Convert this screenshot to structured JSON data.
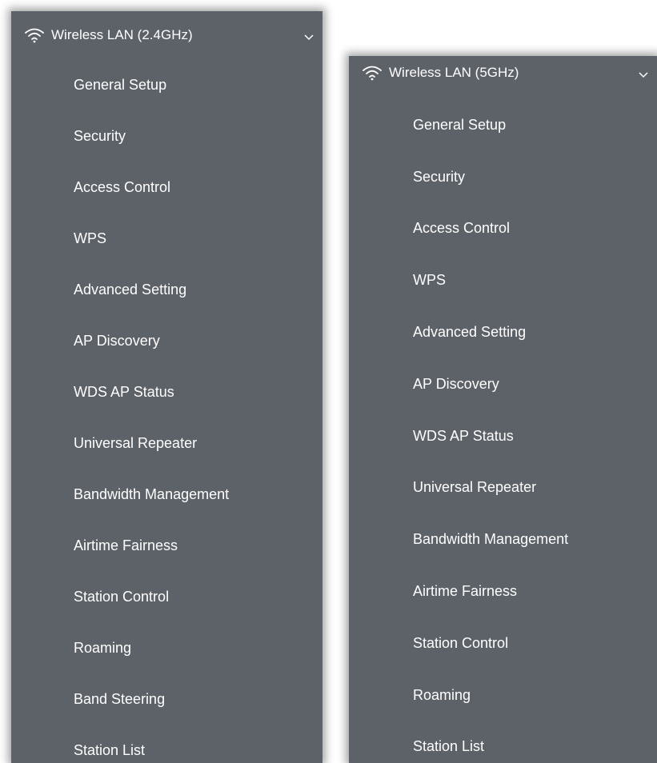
{
  "panel_24ghz": {
    "title": "Wireless LAN (2.4GHz)",
    "items": [
      {
        "label": "General Setup"
      },
      {
        "label": "Security"
      },
      {
        "label": "Access Control"
      },
      {
        "label": "WPS"
      },
      {
        "label": "Advanced Setting"
      },
      {
        "label": "AP Discovery"
      },
      {
        "label": "WDS AP Status"
      },
      {
        "label": "Universal Repeater"
      },
      {
        "label": "Bandwidth Management"
      },
      {
        "label": "Airtime Fairness"
      },
      {
        "label": "Station Control"
      },
      {
        "label": "Roaming"
      },
      {
        "label": "Band Steering"
      },
      {
        "label": "Station List"
      }
    ]
  },
  "panel_5ghz": {
    "title": "Wireless LAN (5GHz)",
    "items": [
      {
        "label": "General Setup"
      },
      {
        "label": "Security"
      },
      {
        "label": "Access Control"
      },
      {
        "label": "WPS"
      },
      {
        "label": "Advanced Setting"
      },
      {
        "label": "AP Discovery"
      },
      {
        "label": "WDS AP Status"
      },
      {
        "label": "Universal Repeater"
      },
      {
        "label": "Bandwidth Management"
      },
      {
        "label": "Airtime Fairness"
      },
      {
        "label": "Station Control"
      },
      {
        "label": "Roaming"
      },
      {
        "label": "Station List"
      }
    ]
  },
  "icons": {
    "header": "wifi-icon",
    "expand": "chevron-down-icon"
  },
  "colors": {
    "panel_background": "#5d6168",
    "text": "#ffffff"
  }
}
